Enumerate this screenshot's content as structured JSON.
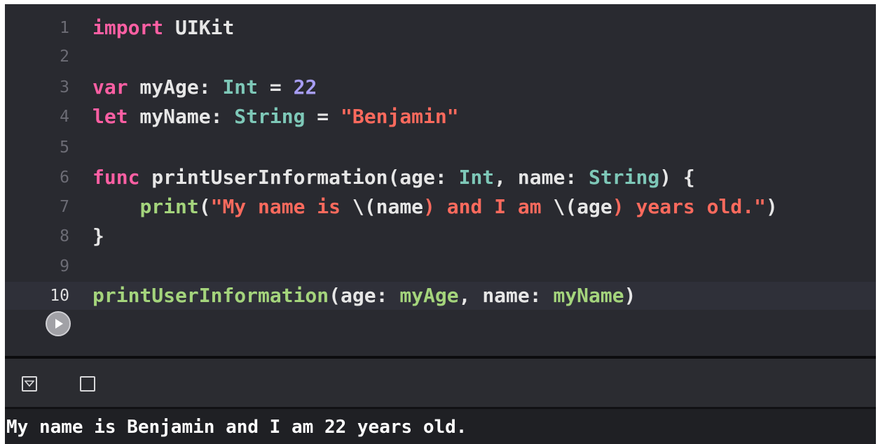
{
  "editor": {
    "lines": [
      {
        "number": "1",
        "tokens": [
          {
            "text": "import",
            "kind": "keyword"
          },
          {
            "text": " UIKit",
            "kind": "plain"
          }
        ]
      },
      {
        "number": "2",
        "tokens": []
      },
      {
        "number": "3",
        "tokens": [
          {
            "text": "var",
            "kind": "keyword"
          },
          {
            "text": " myAge: ",
            "kind": "plain"
          },
          {
            "text": "Int",
            "kind": "type"
          },
          {
            "text": " = ",
            "kind": "plain"
          },
          {
            "text": "22",
            "kind": "number"
          }
        ]
      },
      {
        "number": "4",
        "tokens": [
          {
            "text": "let",
            "kind": "keyword"
          },
          {
            "text": " myName: ",
            "kind": "plain"
          },
          {
            "text": "String",
            "kind": "type"
          },
          {
            "text": " = ",
            "kind": "plain"
          },
          {
            "text": "\"Benjamin\"",
            "kind": "string"
          }
        ]
      },
      {
        "number": "5",
        "tokens": []
      },
      {
        "number": "6",
        "tokens": [
          {
            "text": "func",
            "kind": "keyword"
          },
          {
            "text": " printUserInformation(age: ",
            "kind": "plain"
          },
          {
            "text": "Int",
            "kind": "type"
          },
          {
            "text": ", name: ",
            "kind": "plain"
          },
          {
            "text": "String",
            "kind": "type"
          },
          {
            "text": ") {",
            "kind": "plain"
          }
        ]
      },
      {
        "number": "7",
        "tokens": [
          {
            "text": "    ",
            "kind": "plain"
          },
          {
            "text": "print",
            "kind": "func"
          },
          {
            "text": "(",
            "kind": "plain"
          },
          {
            "text": "\"My name is ",
            "kind": "string"
          },
          {
            "text": "\\(name",
            "kind": "plain"
          },
          {
            "text": ") and I am ",
            "kind": "string"
          },
          {
            "text": "\\(age",
            "kind": "plain"
          },
          {
            "text": ") years old.\"",
            "kind": "string"
          },
          {
            "text": ")",
            "kind": "plain"
          }
        ]
      },
      {
        "number": "8",
        "tokens": [
          {
            "text": "}",
            "kind": "plain"
          }
        ]
      },
      {
        "number": "9",
        "tokens": []
      },
      {
        "number": "10",
        "current": true,
        "tokens": [
          {
            "text": "printUserInformation",
            "kind": "func"
          },
          {
            "text": "(age: ",
            "kind": "plain"
          },
          {
            "text": "myAge",
            "kind": "func"
          },
          {
            "text": ", name: ",
            "kind": "plain"
          },
          {
            "text": "myName",
            "kind": "func"
          },
          {
            "text": ")",
            "kind": "plain"
          }
        ]
      }
    ],
    "run_button_icon": "play-icon"
  },
  "debug_bar": {
    "hide_console_icon": "hide-debug-area-icon",
    "clear_console_icon": "clear-console-icon"
  },
  "console": {
    "output": "My name is Benjamin and I am 22 years old."
  },
  "colors": {
    "background": "#292a30",
    "keyword": "#fc5fa3",
    "type": "#5dd8ff",
    "type_declared": "#7ec8b8",
    "number": "#d0bf69",
    "number_literal": "#a79df4",
    "string": "#fc6a5d",
    "func": "#a4d47c",
    "plain": "#e6e6e6",
    "line_number": "#6c6c75"
  }
}
